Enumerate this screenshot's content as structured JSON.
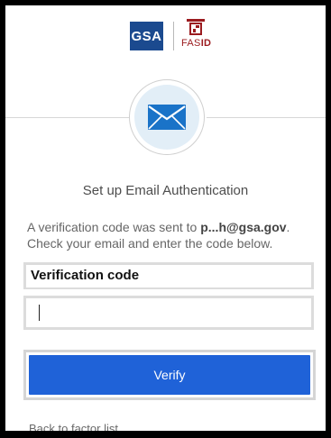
{
  "header": {
    "gsa_logo_text": "GSA",
    "fas_logo_prefix": "FAS",
    "fas_logo_suffix": "ID"
  },
  "factor": {
    "icon": "envelope-icon",
    "icon_color": "#1a73c8",
    "circle_bg": "#e2eef7"
  },
  "title": "Set up Email Authentication",
  "description": {
    "line1_prefix": "A verification code was sent to ",
    "email": "p...h@gsa.gov",
    "line1_suffix": ".",
    "line2": "Check your email and enter the code below."
  },
  "form": {
    "label": "Verification code",
    "value": "",
    "placeholder": ""
  },
  "verify_button": {
    "label": "Verify",
    "color": "#1f62d8"
  },
  "back_link": "Back to factor list"
}
